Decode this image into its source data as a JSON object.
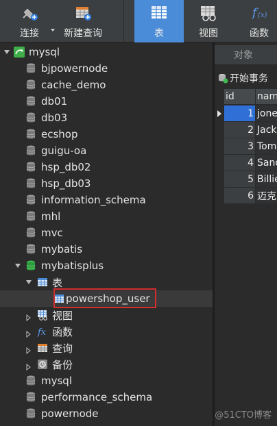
{
  "toolbar": {
    "connect_label": "连接",
    "new_query_label": "新建查询",
    "table_label": "表",
    "view_label": "视图",
    "function_label": "函数"
  },
  "tree": {
    "connection": "mysql",
    "databases_before": [
      "bjpowernode",
      "cache_demo",
      "db01",
      "db03",
      "ecshop",
      "guigu-oa",
      "hsp_db02",
      "hsp_db03",
      "information_schema",
      "mhl",
      "mvc",
      "mybatis"
    ],
    "open_database": "mybatisplus",
    "tables_folder": "表",
    "table_item": "powershop_user",
    "views_folder": "视图",
    "functions_folder": "函数",
    "queries_folder": "查询",
    "backups_folder": "备份",
    "databases_after": [
      "mysql",
      "performance_schema",
      "powernode"
    ]
  },
  "right_panel": {
    "objects_tab": "对象",
    "begin_transaction": "开始事务",
    "columns": [
      "id",
      "nam"
    ],
    "rows": [
      {
        "id": "1",
        "name": "jone"
      },
      {
        "id": "2",
        "name": "Jack"
      },
      {
        "id": "3",
        "name": "Tom"
      },
      {
        "id": "4",
        "name": "Sand"
      },
      {
        "id": "5",
        "name": "Billie"
      },
      {
        "id": "6",
        "name": "迈克"
      }
    ]
  },
  "watermark": "@51CTO博客",
  "colors": {
    "accent": "#4a8cd8",
    "selected_cell": "#2f6fd6",
    "highlight_border": "#d32d2d",
    "db_green": "#3fb950"
  }
}
